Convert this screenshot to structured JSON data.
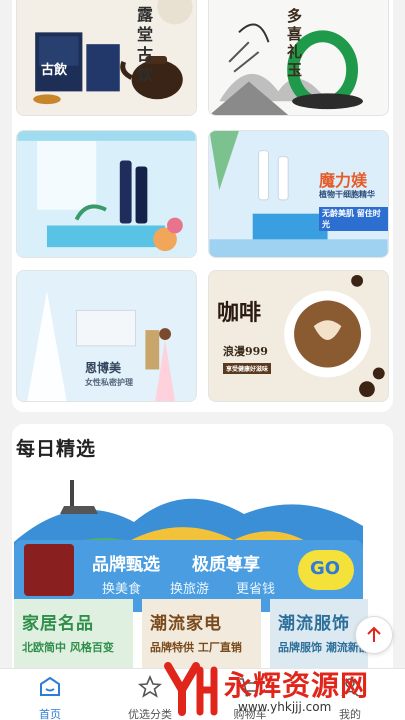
{
  "tiles": [
    {
      "id": "tea",
      "label": "露堂古饮",
      "sub": "古飲"
    },
    {
      "id": "jade",
      "label": "多喜礼玉",
      "sub": ""
    },
    {
      "id": "serum1",
      "label": "",
      "sub": ""
    },
    {
      "id": "serum2",
      "label": "魔力媄",
      "sub": "植物干细胞精华",
      "tag": "无龄美肌 留住时光"
    },
    {
      "id": "wedding",
      "label": "恩博美",
      "sub": "女性私密护理"
    },
    {
      "id": "coffee",
      "label": "咖啡",
      "sub": "浪漫999",
      "tag": "享受健康好滋味"
    }
  ],
  "daily": {
    "title": "每日精选",
    "banner": {
      "line1a": "品牌甄选",
      "line1b": "极质尊享",
      "line2": [
        "换美食",
        "换旅游",
        "更省钱"
      ],
      "go": "GO"
    },
    "categories": [
      {
        "title": "家居名品",
        "sub": "北欧简中 风格百变",
        "color": "#2f8f4a",
        "bg": "#dff0e0"
      },
      {
        "title": "潮流家电",
        "sub": "品牌特供 工厂直销",
        "color": "#7a4a1c",
        "bg": "#f2ebdd"
      },
      {
        "title": "潮流服饰",
        "sub": "品牌服饰 潮流新品",
        "color": "#2b6f9a",
        "bg": "#dde9f1"
      }
    ]
  },
  "tabs": [
    {
      "label": "首页",
      "icon": "home-icon"
    },
    {
      "label": "优选分类",
      "icon": "star-icon"
    },
    {
      "label": "购物车",
      "icon": "cart-icon"
    },
    {
      "label": "我的",
      "icon": "user-icon"
    }
  ],
  "watermark": {
    "brand": "永辉资源网",
    "url": "www.yhkjjj.com"
  },
  "colors": {
    "accent": "#2f7bd8",
    "watermark": "#e0251b"
  }
}
